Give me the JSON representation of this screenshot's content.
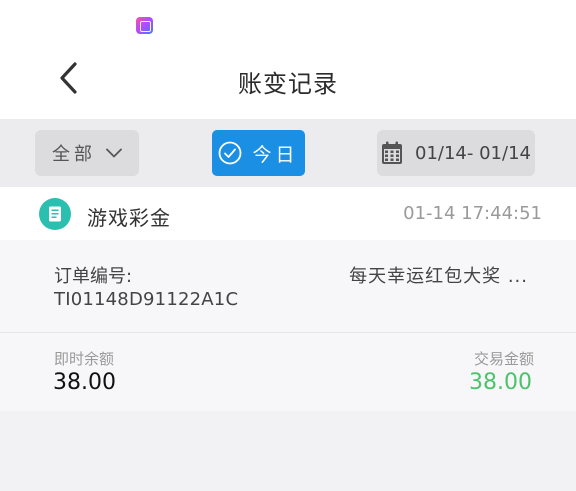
{
  "status_bar": {
    "app_icon": "app-notification-icon"
  },
  "header": {
    "title": "账变记录",
    "back_icon": "chevron-left-icon"
  },
  "filters": {
    "category": {
      "label": "全部",
      "icon": "chevron-down-icon"
    },
    "today": {
      "label": "今日",
      "icon": "check-circle-icon",
      "active": true,
      "color": "#1a8fe3"
    },
    "date_range": {
      "label": "01/14- 01/14",
      "icon": "calendar-icon"
    }
  },
  "records": [
    {
      "category": "游戏彩金",
      "category_icon": "receipt-icon",
      "icon_color": "#2bbfb0",
      "time": "01-14 17:44:51",
      "order_label": "订单编号:",
      "order_number": "TI01148D91122A1C",
      "description": "每天幸运红包大奖 ...",
      "balance_label": "即时余额",
      "balance": "38.00",
      "amount_label": "交易金额",
      "amount": "38.00",
      "amount_color": "#4cc26a"
    }
  ]
}
